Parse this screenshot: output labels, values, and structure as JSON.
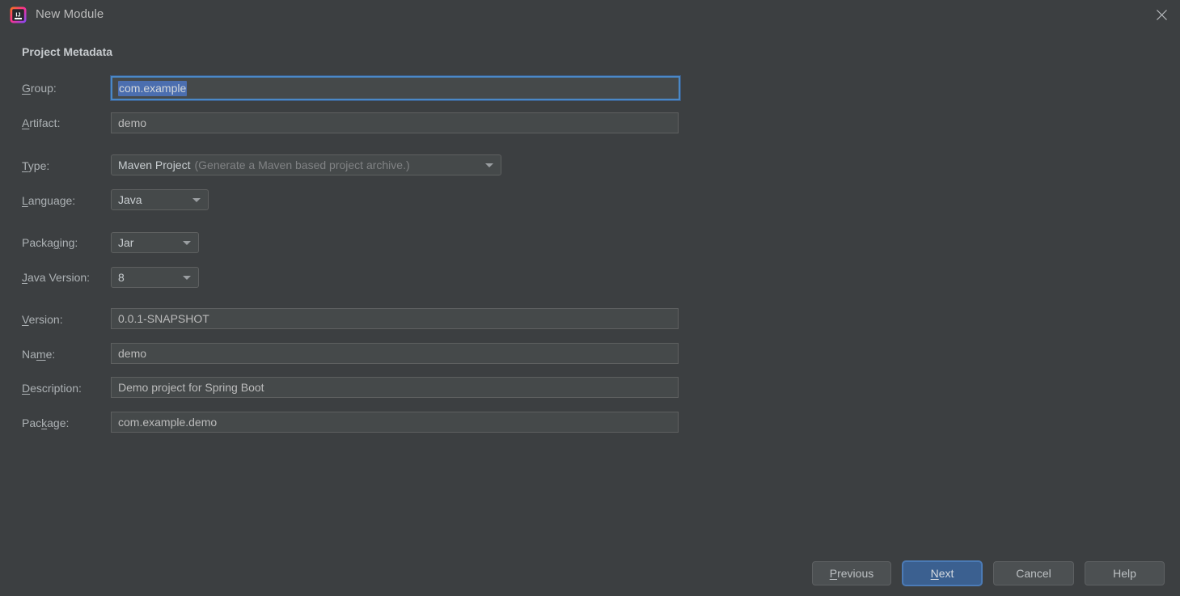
{
  "window": {
    "title": "New Module",
    "app_icon": "intellij-idea-logo-icon",
    "close_icon": "close-icon"
  },
  "section": {
    "title": "Project Metadata"
  },
  "fields": {
    "group": {
      "label_pre": "",
      "label_mnemonic": "G",
      "label_post": "roup:",
      "value": "com.example",
      "selected": true,
      "focused": true
    },
    "artifact": {
      "label_pre": "",
      "label_mnemonic": "A",
      "label_post": "rtifact:",
      "value": "demo"
    },
    "type": {
      "label_pre": "",
      "label_mnemonic": "T",
      "label_post": "ype:",
      "value": "Maven Project",
      "hint": "(Generate a Maven based project archive.)",
      "arrow_icon": "chevron-down-icon"
    },
    "language": {
      "label_pre": "",
      "label_mnemonic": "L",
      "label_post": "anguage:",
      "value": "Java",
      "arrow_icon": "chevron-down-icon"
    },
    "packaging": {
      "label_pre": "Packa",
      "label_mnemonic": "g",
      "label_post": "ing:",
      "value": "Jar",
      "arrow_icon": "chevron-down-icon"
    },
    "java_version": {
      "label_pre": "",
      "label_mnemonic": "J",
      "label_post": "ava Version:",
      "value": "8",
      "arrow_icon": "chevron-down-icon"
    },
    "version": {
      "label_pre": "",
      "label_mnemonic": "V",
      "label_post": "ersion:",
      "value": "0.0.1-SNAPSHOT"
    },
    "name": {
      "label_pre": "Na",
      "label_mnemonic": "m",
      "label_post": "e:",
      "value": "demo"
    },
    "description": {
      "label_pre": "",
      "label_mnemonic": "D",
      "label_post": "escription:",
      "value": "Demo project for Spring Boot"
    },
    "package": {
      "label_pre": "Pac",
      "label_mnemonic": "k",
      "label_post": "age:",
      "value": "com.example.demo"
    }
  },
  "buttons": {
    "previous": {
      "pre": "",
      "mnemonic": "P",
      "post": "revious"
    },
    "next": {
      "pre": "",
      "mnemonic": "N",
      "post": "ext",
      "default": true
    },
    "cancel": {
      "pre": "Cancel",
      "mnemonic": "",
      "post": ""
    },
    "help": {
      "pre": "Help",
      "mnemonic": "",
      "post": ""
    }
  },
  "colors": {
    "dialog_bg": "#3c3f41",
    "field_bg": "#45494a",
    "focus_border": "#4a88c7",
    "selection_bg": "#4b6eaf",
    "default_button_bg": "#3b6090",
    "text": "#b9bdc0",
    "hint_text": "#808284"
  }
}
